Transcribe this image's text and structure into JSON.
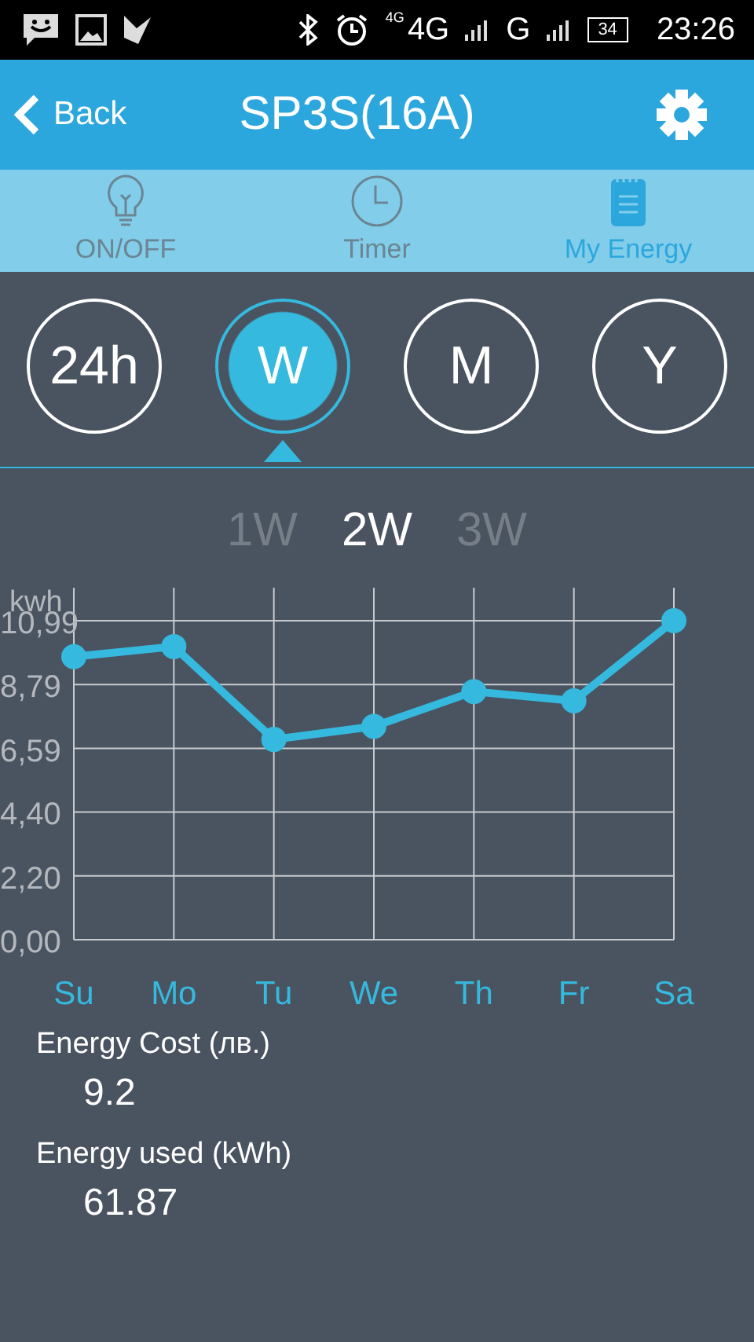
{
  "status_bar": {
    "network_small": "4G",
    "network": "4G",
    "network2": "G",
    "battery": "34",
    "time": "23:26"
  },
  "header": {
    "back": "Back",
    "title": "SP3S(16A)"
  },
  "tabs": [
    {
      "label": "ON/OFF",
      "selected": false
    },
    {
      "label": "Timer",
      "selected": false
    },
    {
      "label": "My Energy",
      "selected": true
    }
  ],
  "periods": [
    {
      "label": "24h",
      "selected": false
    },
    {
      "label": "W",
      "selected": true
    },
    {
      "label": "M",
      "selected": false
    },
    {
      "label": "Y",
      "selected": false
    }
  ],
  "ranges": [
    {
      "label": "1W",
      "selected": false
    },
    {
      "label": "2W",
      "selected": true
    },
    {
      "label": "3W",
      "selected": false
    }
  ],
  "chart": {
    "chart_data": {
      "type": "line",
      "ylabel": "kwh",
      "categories": [
        "Su",
        "Mo",
        "Tu",
        "We",
        "Th",
        "Fr",
        "Sa"
      ],
      "grid": true,
      "series": [
        {
          "color": "#35b9de",
          "marker": "circle",
          "values": [
            9.75,
            10.1,
            6.9,
            7.35,
            8.55,
            8.23,
            10.99
          ]
        }
      ],
      "ylim": [
        0,
        10.99
      ],
      "yticks": [
        {
          "value": 0,
          "label": "0,00"
        },
        {
          "value": 2.2,
          "label": "2,20"
        },
        {
          "value": 4.4,
          "label": "4,40"
        },
        {
          "value": 6.59,
          "label": "6,59"
        },
        {
          "value": 8.79,
          "label": "8,79"
        },
        {
          "value": 10.99,
          "label": "10,99"
        }
      ]
    }
  },
  "summary": [
    {
      "label": "Energy Cost (лв.)",
      "value": "9.2"
    },
    {
      "label": "Energy used (kWh)",
      "value": "61.87"
    }
  ]
}
